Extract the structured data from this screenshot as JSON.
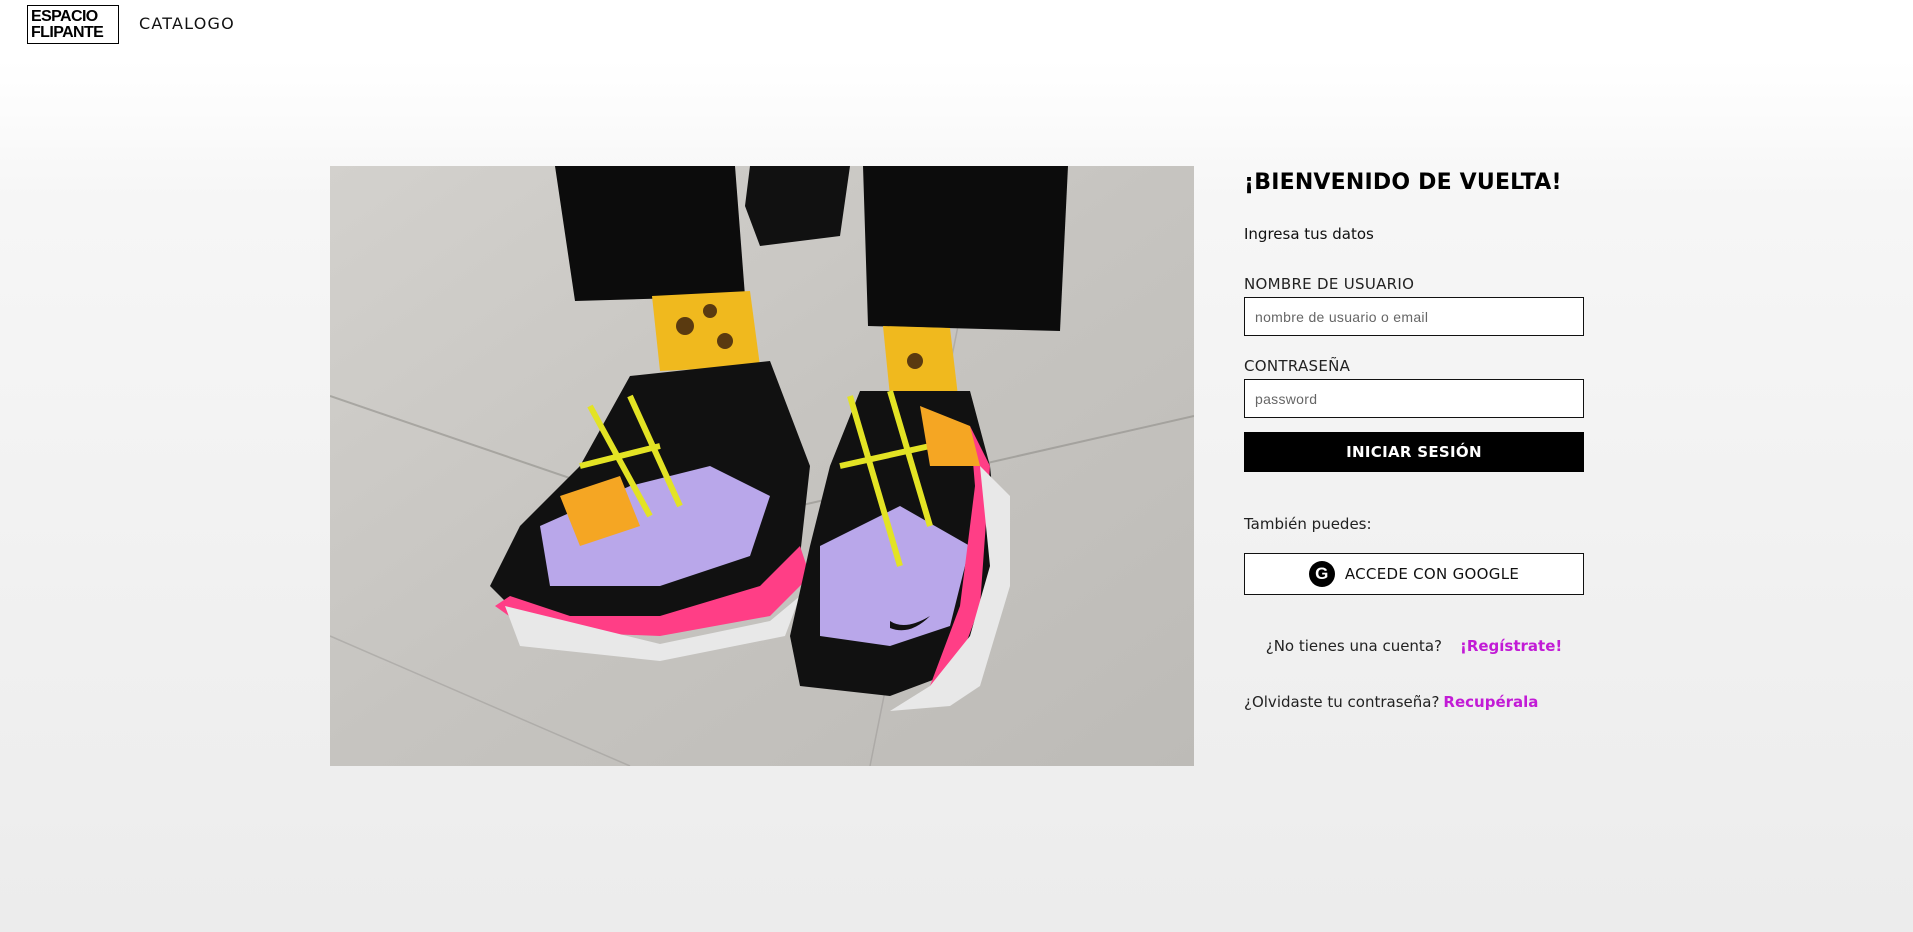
{
  "header": {
    "logo_line1": "ESPACIO",
    "logo_line2": "FLIPANTE",
    "nav_catalog": "CATALOGO"
  },
  "login": {
    "title": "¡BIENVENIDO DE VUELTA!",
    "subtitle": "Ingresa tus datos",
    "username_label": "NOMBRE DE USUARIO",
    "username_placeholder": "nombre de usuario o email",
    "username_value": "",
    "password_label": "CONTRASEÑA",
    "password_placeholder": "password",
    "password_value": "",
    "submit_label": "INICIAR SESIÓN",
    "alt_text": "También puedes:",
    "google_icon": "google-icon",
    "google_label": "ACCEDE CON GOOGLE",
    "no_account_text": "¿No tienes una cuenta?",
    "register_link": "¡Regístrate!",
    "forgot_text": "¿Olvidaste tu contraseña?",
    "recover_link": "Recupérala"
  },
  "colors": {
    "accent_link": "#c21bd6",
    "button_bg": "#000000"
  }
}
